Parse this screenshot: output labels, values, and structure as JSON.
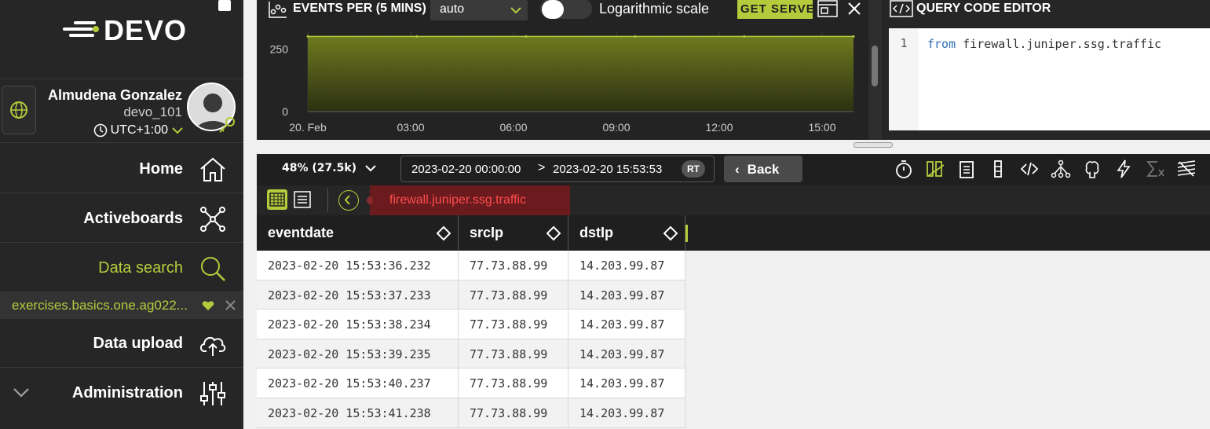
{
  "brand": {
    "name": "DEVO"
  },
  "user": {
    "name": "Almudena Gonzalez",
    "domain": "devo_101",
    "timezone": "UTC+1:00"
  },
  "nav": {
    "home": "Home",
    "activeboards": "Activeboards",
    "data_search": "Data search",
    "sub_query": "exercises.basics.one.ag022...",
    "data_upload": "Data upload",
    "administration": "Administration"
  },
  "chart_header": {
    "title": "EVENTS PER (5 MINS)",
    "interval": "auto",
    "log_label": "Logarithmic scale",
    "get_server": "GET SERVE"
  },
  "chart_data": {
    "type": "area",
    "x": [
      "20. Feb",
      "03:00",
      "06:00",
      "09:00",
      "12:00",
      "15:00"
    ],
    "y_ticks": [
      0,
      250
    ],
    "series": [
      {
        "values": [
          300,
          300,
          300,
          300,
          300,
          300
        ]
      }
    ],
    "ylim": [
      0,
      320
    ],
    "color": "#b5cb3c"
  },
  "editor": {
    "title": "QUERY CODE EDITOR",
    "line_number": "1",
    "keyword": "from",
    "code_rest": " firewall.juniper.ssg.traffic"
  },
  "toolbar": {
    "sample": "48% (27.5k)",
    "from": "2023-02-20 00:00:00",
    "arrow": ">",
    "to": "2023-02-20 15:53:53",
    "rt": "RT",
    "back": "Back"
  },
  "tab": {
    "query": "firewall.juniper.ssg.traffic"
  },
  "table": {
    "columns": [
      "eventdate",
      "srcIp",
      "dstIp"
    ],
    "rows": [
      [
        "2023-02-20 15:53:36.232",
        "77.73.88.99",
        "14.203.99.87"
      ],
      [
        "2023-02-20 15:53:37.233",
        "77.73.88.99",
        "14.203.99.87"
      ],
      [
        "2023-02-20 15:53:38.234",
        "77.73.88.99",
        "14.203.99.87"
      ],
      [
        "2023-02-20 15:53:39.235",
        "77.73.88.99",
        "14.203.99.87"
      ],
      [
        "2023-02-20 15:53:40.237",
        "77.73.88.99",
        "14.203.99.87"
      ],
      [
        "2023-02-20 15:53:41.238",
        "77.73.88.99",
        "14.203.99.87"
      ]
    ]
  },
  "colors": {
    "accent": "#b5cb3c",
    "tab_bg": "#6b1a1e",
    "tab_text": "#ff4d4d"
  }
}
